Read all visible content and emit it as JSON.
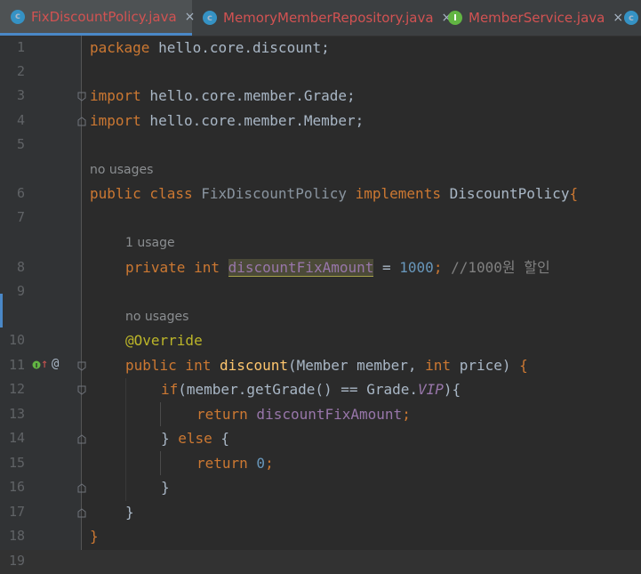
{
  "tabs": [
    {
      "label": "FixDiscountPolicy.java",
      "icon": "class-icon",
      "icon_letter": "c",
      "active": true,
      "close": "×"
    },
    {
      "label": "MemoryMemberRepository.java",
      "icon": "class-icon",
      "icon_letter": "c",
      "active": false,
      "close": "×"
    },
    {
      "label": "MemberService.java",
      "icon": "interface-icon",
      "icon_letter": "I",
      "active": false,
      "close": "×"
    },
    {
      "label": "",
      "icon": "class-icon",
      "icon_letter": "c",
      "active": false,
      "close": ""
    }
  ],
  "gutter": {
    "line_numbers": [
      "1",
      "2",
      "3",
      "4",
      "5",
      "6",
      "7",
      "8",
      "9",
      "10",
      "11",
      "12",
      "13",
      "14",
      "15",
      "16",
      "17",
      "18",
      "19"
    ],
    "line11_icons": {
      "implements_marker": "↑",
      "annotation_marker": "@"
    }
  },
  "hints": {
    "class_usages": "no usages",
    "field_usages": "1 usage",
    "method_usages": "no usages"
  },
  "code": {
    "l1_kw": "package",
    "l1_rest": " hello.core.discount;",
    "l3_kw": "import",
    "l3_rest": " hello.core.member.Grade;",
    "l4_kw": "import",
    "l4_rest": " hello.core.member.Member;",
    "l6_kw1": "public class",
    "l6_name": " FixDiscountPolicy ",
    "l6_kw2": "implements",
    "l6_iface": " DiscountPolicy",
    "l6_brace": "{",
    "l8_kw": "private int",
    "l8_field": "discountFixAmount",
    "l8_eq": " = ",
    "l8_num": "1000",
    "l8_semi": "; ",
    "l8_comment": "//1000원 할인",
    "l10_ann": "@Override",
    "l11_kw": "public int",
    "l11_method": " discount",
    "l11_p1": "(Member member, ",
    "l11_kw2": "int",
    "l11_p2": " price) ",
    "l11_brace": "{",
    "l12_kw": "if",
    "l12_a": "(member.getGrade() == Grade.",
    "l12_vip": "VIP",
    "l12_b": "){",
    "l13_kw": "return",
    "l13_field": " discountFixAmount",
    "l13_semi": ";",
    "l14_a": "} ",
    "l14_kw": "else",
    "l14_b": " {",
    "l15_kw": "return",
    "l15_num": " 0",
    "l15_semi": ";",
    "l16": "}",
    "l17": "}",
    "l18": "}"
  },
  "colors": {
    "background": "#2b2b2b",
    "keyword": "#cc7832",
    "field": "#9876aa",
    "number": "#6897bb",
    "comment": "#808080",
    "annotation": "#bbb529",
    "method": "#ffc66d",
    "tab_active_label": "#d25252"
  }
}
